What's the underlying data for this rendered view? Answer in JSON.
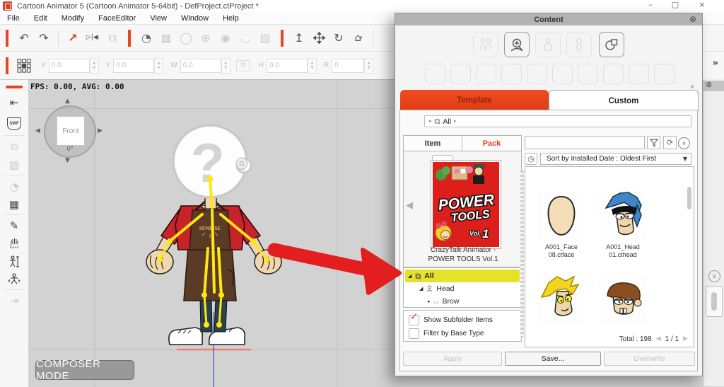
{
  "window": {
    "title": "Cartoon Animator 5  (Cartoon Animator 5-64bit) - DefProject.ctProject *"
  },
  "icons": {
    "minimize": "–",
    "maximize": "▢",
    "close": "×",
    "circle_close": "⊗",
    "undo": "↶",
    "redo": "↷",
    "select": "↗",
    "flip": "▷|◀",
    "caret_down": "▾",
    "link": "⧉",
    "head_create": "◔",
    "grid_tool": "▦",
    "face_tool": "◯",
    "face_mesh": "⊕",
    "eye_tool": "◉",
    "lips_tool": "◡",
    "photo_tool": "▨",
    "anchor": "↥",
    "rotate": "↻",
    "home": "⌂",
    "overflow": "»",
    "composer_exit": "⇤",
    "duplicate": "⧉",
    "mask": "▨",
    "head_plus": "◔",
    "panel_grid": "▦",
    "sprite_edit": "✎",
    "send_out": "⇥",
    "collapse": "«",
    "bc_sep": "▸",
    "folder_stack": "⧉",
    "tree_open": "◢",
    "tree_closed": "▸",
    "dd_caret": "▼",
    "pager_prev": "◀",
    "pager_next": "▶",
    "pack_prev": "◀",
    "check": "✓",
    "chevron": "∨",
    "clock": "◷",
    "refresh": "⟳",
    "tri_up": "▲",
    "tri_down": "▼",
    "tri_left": "◀",
    "tri_right": "▶"
  },
  "menu": {
    "items": [
      "File",
      "Edit",
      "Modify",
      "FaceEditor",
      "View",
      "Window",
      "Help"
    ]
  },
  "transform": {
    "fields": [
      {
        "label": "X",
        "value": "0.0"
      },
      {
        "label": "Y",
        "value": "0.0"
      },
      {
        "label": "W",
        "value": "0.0"
      },
      {
        "label": "H",
        "value": "0.0"
      },
      {
        "label": "R",
        "value": "0"
      }
    ]
  },
  "sidebar": {
    "swf_label": "SWF",
    "gesture_label": "G1+2"
  },
  "canvas": {
    "fps_text": "FPS: 0.00, AVG: 0.00",
    "camera": {
      "label": "Front",
      "angle": "0°"
    },
    "mode_badge": "COMPOSER MODE",
    "character": {
      "placeholder_glyph": "?",
      "apron_text": "SUNRISE",
      "gizmo_badge": "G"
    }
  },
  "content": {
    "title": "Content",
    "tabs": {
      "template": "Template",
      "custom": "Custom"
    },
    "breadcrumb": {
      "root": "All"
    },
    "subtabs": {
      "item": "Item",
      "pack": "Pack"
    },
    "pack": {
      "cover": {
        "word1": "POWER",
        "word2": "TOOLS",
        "vol": "Vol.",
        "vol_num": "1"
      },
      "caption1": "CrazyTalk Animator -",
      "caption2": "POWER TOOLS Vol.1"
    },
    "tree": [
      {
        "label": "All"
      },
      {
        "label": "Head"
      },
      {
        "label": "Brow"
      }
    ],
    "options": [
      {
        "label": "Show Subfolder Items",
        "checked": true
      },
      {
        "label": "Filter by Base Type",
        "checked": false
      }
    ],
    "sort_value": "Sort by Installed Date : Oldest First",
    "grid": {
      "items": [
        {
          "line1": "A001_Face",
          "line2": "08.ctface"
        },
        {
          "line1": "A001_Head",
          "line2": "01.cthead"
        }
      ],
      "total": "Total : 198",
      "page": "1 / 1"
    },
    "buttons": {
      "apply": "Apply",
      "save": "Save...",
      "overwrite": "Overwrite"
    }
  }
}
